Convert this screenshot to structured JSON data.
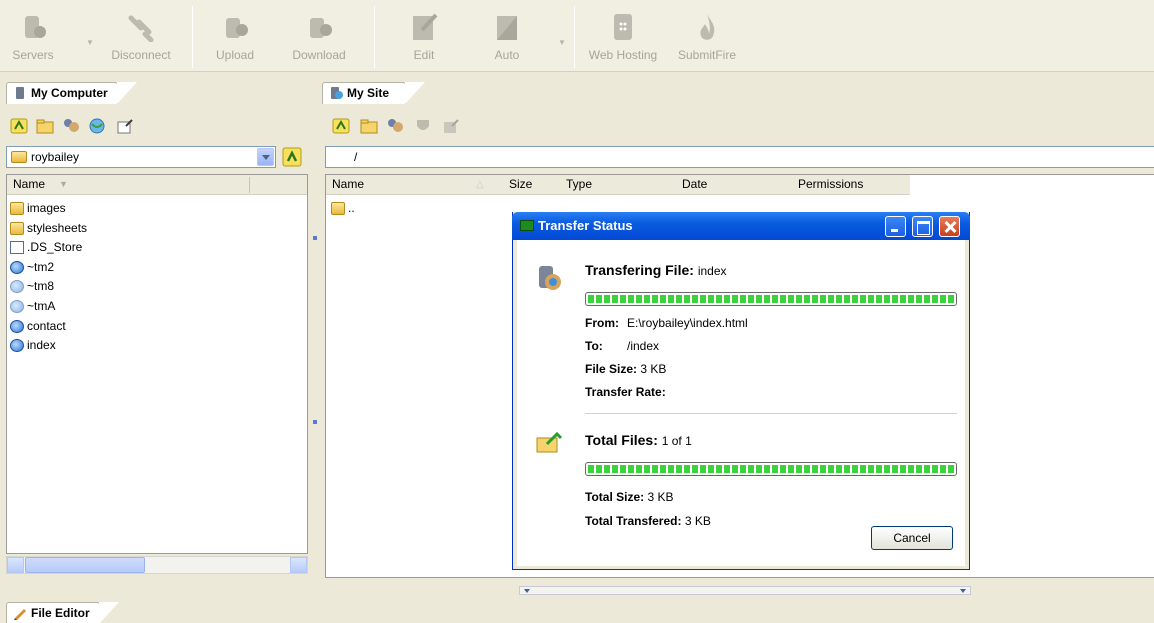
{
  "toolbar": {
    "servers": "Servers",
    "disconnect": "Disconnect",
    "upload": "Upload",
    "download": "Download",
    "edit": "Edit",
    "auto": "Auto",
    "web_hosting": "Web Hosting",
    "submitfire": "SubmitFire"
  },
  "left_panel": {
    "tab_label": "My Computer",
    "path": "roybailey",
    "column_name": "Name",
    "items": [
      {
        "name": "images",
        "icon": "folder-icon"
      },
      {
        "name": "stylesheets",
        "icon": "folder-icon"
      },
      {
        "name": ".DS_Store",
        "icon": "file-icon"
      },
      {
        "name": "~tm2",
        "icon": "ie-document-icon"
      },
      {
        "name": "~tm8",
        "icon": "ie-document-icon"
      },
      {
        "name": "~tmA",
        "icon": "ie-document-icon"
      },
      {
        "name": "contact",
        "icon": "ie-document-icon"
      },
      {
        "name": "index",
        "icon": "ie-document-icon"
      }
    ]
  },
  "right_panel": {
    "tab_label": "My Site",
    "path": "/",
    "columns": {
      "name": "Name",
      "size": "Size",
      "type": "Type",
      "date": "Date",
      "permissions": "Permissions"
    },
    "items": [
      {
        "name": "..",
        "icon": "folder-icon"
      }
    ]
  },
  "dialog": {
    "title": "Transfer Status",
    "transfer_label": "Transfering File:",
    "transfer_file": "index",
    "file_progress": 1.0,
    "from_label": "From:",
    "from_value": "E:\\roybailey\\index.html",
    "to_label": "To:",
    "to_value": "/index",
    "file_size_label": "File Size:",
    "file_size_value": "3 KB",
    "rate_label": "Transfer Rate:",
    "total_files_label": "Total Files:",
    "total_files_value": "1 of 1",
    "total_progress": 1.0,
    "total_size_label": "Total Size:",
    "total_size_value": "3 KB",
    "total_transfered_label": "Total Transfered:",
    "total_transfered_value": "3 KB",
    "cancel": "Cancel"
  },
  "bottom_tab": {
    "label": "File Editor"
  }
}
